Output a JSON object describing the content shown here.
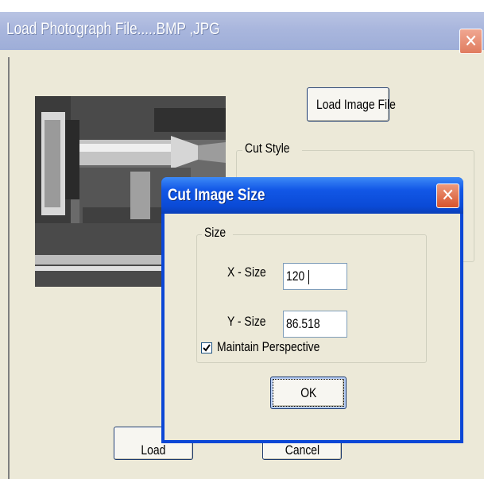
{
  "outer_dialog": {
    "title": "Load Photograph File.....BMP ,JPG",
    "close_glyph": "✕",
    "load_image_button": "Load Image File",
    "cut_style_label": "Cut Style",
    "load_button": "Load",
    "cancel_button": "Cancel"
  },
  "inner_dialog": {
    "title": "Cut Image Size",
    "close_glyph": "✕",
    "size_group_label": "Size",
    "x_label": "X - Size",
    "x_value": "120",
    "y_label": "Y - Size",
    "y_value": "86.518",
    "maintain_perspective_label": "Maintain Perspective",
    "maintain_perspective_checked": true,
    "ok_button": "OK"
  },
  "icons": {
    "close": "close-icon",
    "checkbox": "checkbox-checked-icon"
  },
  "colors": {
    "dialog_bg": "#ece9d8",
    "active_title": "#0a4ad6",
    "inactive_title": "#a9b6dd",
    "close_button": "#e07c5f"
  }
}
